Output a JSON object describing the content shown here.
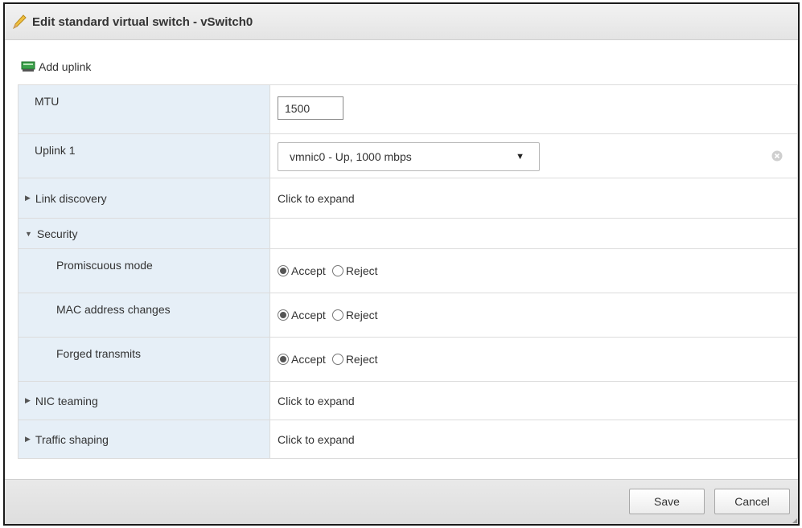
{
  "dialog": {
    "title": "Edit standard virtual switch - vSwitch0",
    "title_icon": "pencil-icon"
  },
  "toolbar": {
    "add_uplink_label": "Add uplink",
    "add_uplink_icon": "network-adapter-icon"
  },
  "mtu": {
    "label": "MTU",
    "value": "1500"
  },
  "uplink": {
    "label": "Uplink 1",
    "selected": "vmnic0 - Up, 1000 mbps"
  },
  "link_discovery": {
    "label": "Link discovery",
    "value": "Click to expand"
  },
  "security": {
    "label": "Security",
    "rows": [
      {
        "label": "Promiscuous mode",
        "accept": "Accept",
        "reject": "Reject",
        "selected": "Accept"
      },
      {
        "label": "MAC address changes",
        "accept": "Accept",
        "reject": "Reject",
        "selected": "Accept"
      },
      {
        "label": "Forged transmits",
        "accept": "Accept",
        "reject": "Reject",
        "selected": "Accept"
      }
    ]
  },
  "nic_teaming": {
    "label": "NIC teaming",
    "value": "Click to expand"
  },
  "traffic_shaping": {
    "label": "Traffic shaping",
    "value": "Click to expand"
  },
  "footer": {
    "save_label": "Save",
    "cancel_label": "Cancel"
  },
  "colors": {
    "label_background": "#e6eff7",
    "titlebar": "#e8e8e8",
    "footer": "#e2e2e2"
  }
}
